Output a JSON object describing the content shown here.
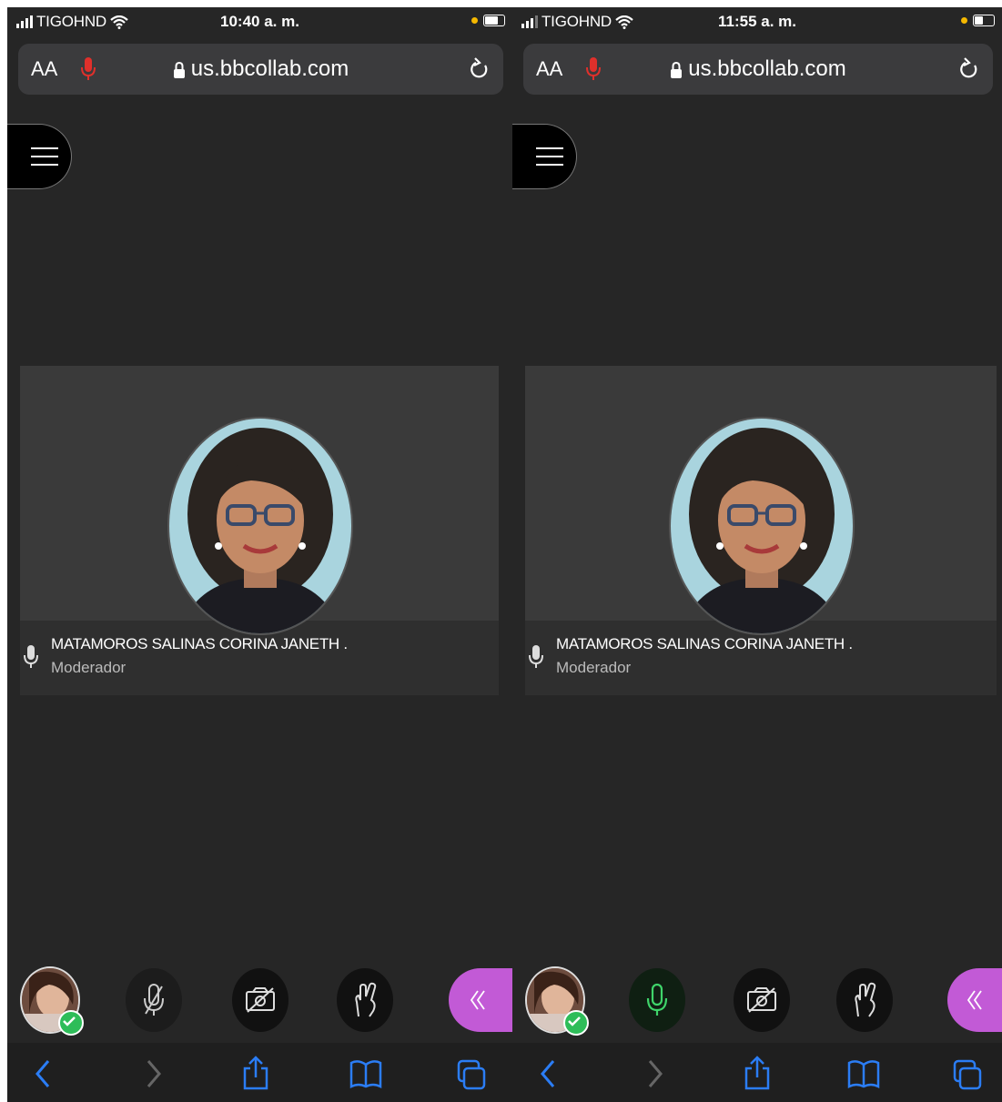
{
  "screens": [
    {
      "status": {
        "carrier": "TIGOHND",
        "time": "10:40 a. m."
      },
      "browser": {
        "text_size": "AA",
        "url": "us.bbcollab.com"
      },
      "participant": {
        "name": "MATAMOROS SALINAS CORINA JANETH .",
        "role": "Moderador"
      },
      "mic_state": "muted",
      "colors": {
        "accent": "#c25ad6",
        "mic_bar": "#e0302b"
      }
    },
    {
      "status": {
        "carrier": "TIGOHND",
        "time": "11:55 a. m."
      },
      "browser": {
        "text_size": "AA",
        "url": "us.bbcollab.com"
      },
      "participant": {
        "name": "MATAMOROS SALINAS CORINA JANETH .",
        "role": "Moderador"
      },
      "mic_state": "active",
      "colors": {
        "accent": "#c25ad6",
        "mic_active": "#3fd46a"
      }
    }
  ],
  "icons": {
    "browser": [
      "signal-icon",
      "wifi-icon",
      "battery-icon",
      "microphone-icon",
      "lock-icon",
      "reload-icon"
    ],
    "collab": [
      "menu-icon",
      "microphone-icon",
      "camera-off-icon",
      "raise-hand-icon",
      "chevron-left-double-icon",
      "success-check-icon"
    ],
    "safari": [
      "back-icon",
      "forward-icon",
      "share-icon",
      "bookmarks-icon",
      "tabs-icon"
    ]
  }
}
